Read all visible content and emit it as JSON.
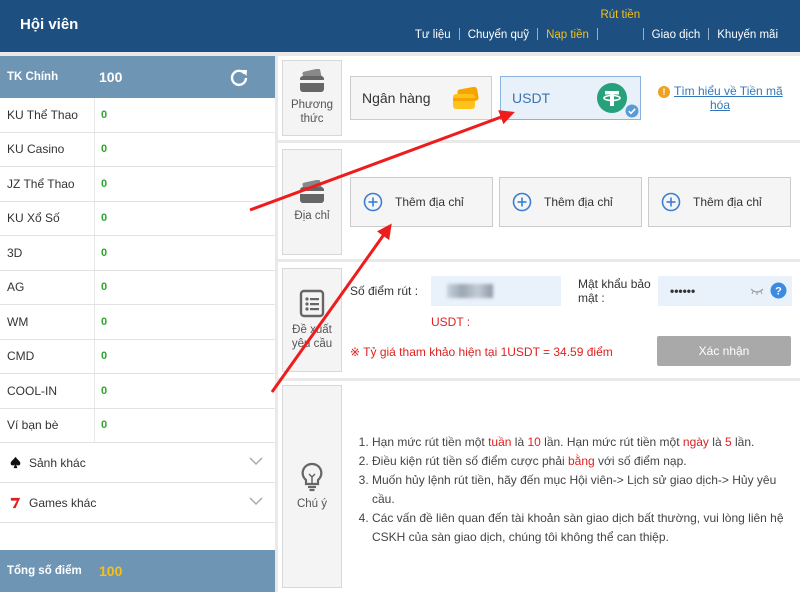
{
  "header": {
    "title": "Hội viên",
    "nav": [
      "Tư liệu",
      "Chuyển quỹ",
      "Nạp tiền",
      "Rút tiền",
      "Giao dịch",
      "Khuyến mãi"
    ]
  },
  "sidebar": {
    "main": {
      "label": "TK Chính",
      "value": "100"
    },
    "items": [
      {
        "name": "KU Thể Thao",
        "value": "0"
      },
      {
        "name": "KU Casino",
        "value": "0"
      },
      {
        "name": "JZ Thể Thao",
        "value": "0"
      },
      {
        "name": "KU Xổ Số",
        "value": "0"
      },
      {
        "name": "3D",
        "value": "0"
      },
      {
        "name": "AG",
        "value": "0"
      },
      {
        "name": "WM",
        "value": "0"
      },
      {
        "name": "CMD",
        "value": "0"
      },
      {
        "name": "COOL-IN",
        "value": "0"
      },
      {
        "name": "Ví bạn bè",
        "value": "0"
      }
    ],
    "groups": [
      {
        "name": "Sảnh khác",
        "icon": "spade-icon"
      },
      {
        "name": "Games khác",
        "icon": "seven-icon"
      }
    ],
    "total": {
      "label": "Tổng số điểm",
      "value": "100"
    }
  },
  "method": {
    "label_1": "Phương",
    "label_2": "thức",
    "bank": "Ngân hàng",
    "usdt": "USDT",
    "learn_1": "Tìm hiểu về Tiền mã",
    "learn_2": "hóa"
  },
  "address": {
    "label": "Địa chỉ",
    "add_label": "Thêm địa chỉ"
  },
  "request": {
    "label_1": "Đề xuất",
    "label_2": "yêu cầu",
    "points_label": "Số điểm rút :",
    "password_label_1": "Mật khẩu bảo",
    "password_label_2": "mật :",
    "password_value": "••••••",
    "usdt_label": "USDT :",
    "rate_note": "※ Tỷ giá tham khảo hiện tại 1USDT = 34.59 điểm",
    "confirm": "Xác nhận"
  },
  "notes": {
    "label": "Chú ý",
    "n1_a": "Hạn mức rút tiền một ",
    "n1_b": "tuần",
    "n1_c": " là ",
    "n1_d": "10",
    "n1_e": " lần. Hạn mức rút tiền một ",
    "n1_f": "ngày",
    "n1_g": " là ",
    "n1_h": "5",
    "n1_i": " lần.",
    "n2_a": "Điều kiện rút tiền số điểm cược phải ",
    "n2_b": "bằng",
    "n2_c": " với số điểm nạp.",
    "n3": "Muốn hủy lệnh rút tiền, hãy đến mục Hội viên-> Lịch sử giao dịch-> Hủy yêu cầu.",
    "n4": "Các vấn đề liên quan đến tài khoản sàn giao dịch bất thường, vui lòng liên hệ CSKH của sàn giao dịch, chúng tôi không thể can thiệp."
  },
  "colors": {
    "header": "#1d4f80",
    "sidebar_accent": "#6f95b5",
    "gold": "#f5c018",
    "green": "#2ea62e",
    "red": "#e02020",
    "link": "#3377bb",
    "arrow": "#ee1c1c"
  }
}
